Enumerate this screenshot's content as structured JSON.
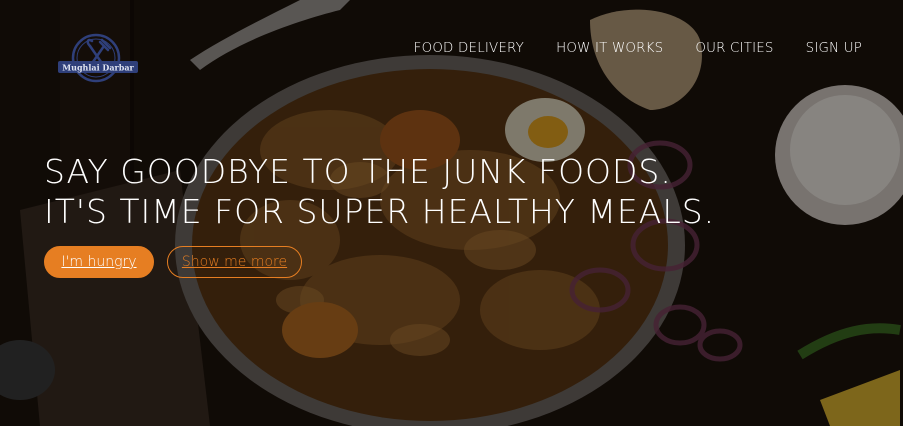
{
  "brand": {
    "logo_text": "Mughlai Darbar",
    "logo_icon": "fork-knife-icon",
    "accent": "#e67e22"
  },
  "nav": {
    "items": [
      {
        "label": "FOOD DELIVERY"
      },
      {
        "label": "HOW IT WORKS"
      },
      {
        "label": "OUR CITIES"
      },
      {
        "label": "SIGN UP"
      }
    ]
  },
  "hero": {
    "headline_line1": "SAY GOODBYE TO THE JUNK FOODS.",
    "headline_line2": "IT'S TIME FOR SUPER HEALTHY MEALS.",
    "primary_button": "I'm hungry",
    "secondary_button": "Show me more",
    "background_image": "biryani-dish-photo"
  }
}
